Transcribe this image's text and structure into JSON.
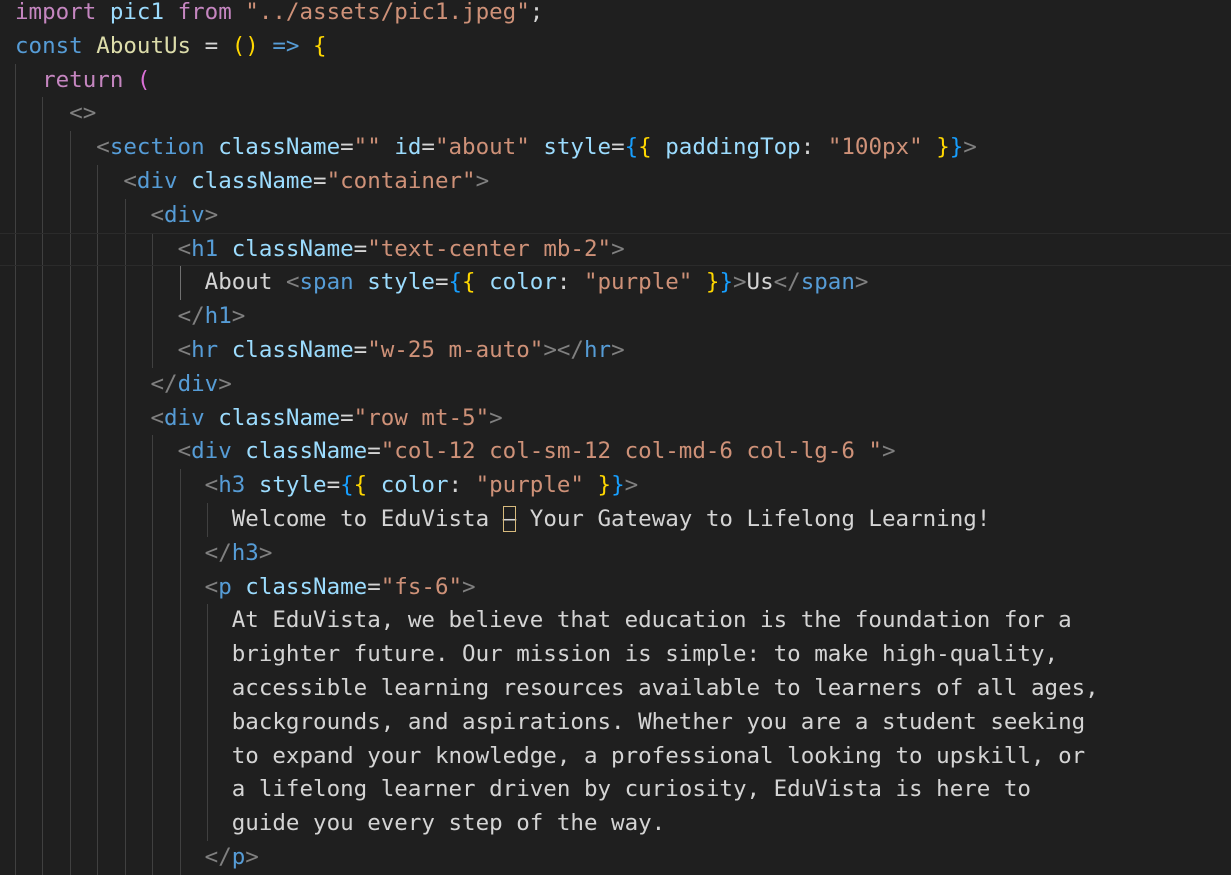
{
  "editor": {
    "lines": [
      [
        [
          "import",
          "ctl"
        ],
        [
          " ",
          "text"
        ],
        [
          "pic1",
          "var"
        ],
        [
          " ",
          "text"
        ],
        [
          "from",
          "ctl"
        ],
        [
          " ",
          "text"
        ],
        [
          "\"../assets/pic1.jpeg\"",
          "str"
        ],
        [
          ";",
          "text"
        ]
      ],
      [
        [
          "const",
          "kw"
        ],
        [
          " ",
          "text"
        ],
        [
          "AboutUs",
          "fn"
        ],
        [
          " = ",
          "op"
        ],
        [
          "()",
          "b1"
        ],
        [
          " ",
          "text"
        ],
        [
          "=>",
          "kw"
        ],
        [
          " ",
          "text"
        ],
        [
          "{",
          "b1"
        ]
      ],
      [
        [
          "  ",
          "text"
        ],
        [
          "return",
          "ctl"
        ],
        [
          " ",
          "text"
        ],
        [
          "(",
          "b2"
        ]
      ],
      [
        [
          "    ",
          "text"
        ],
        [
          "<>",
          "punc"
        ]
      ],
      [
        [
          "      ",
          "text"
        ],
        [
          "<",
          "punc"
        ],
        [
          "section",
          "tag"
        ],
        [
          " ",
          "text"
        ],
        [
          "className",
          "attr"
        ],
        [
          "=",
          "op"
        ],
        [
          "\"\"",
          "str"
        ],
        [
          " ",
          "text"
        ],
        [
          "id",
          "attr"
        ],
        [
          "=",
          "op"
        ],
        [
          "\"about\"",
          "str"
        ],
        [
          " ",
          "text"
        ],
        [
          "style",
          "attr"
        ],
        [
          "=",
          "op"
        ],
        [
          "{",
          "b3"
        ],
        [
          "{",
          "b1"
        ],
        [
          " ",
          "text"
        ],
        [
          "paddingTop",
          "var"
        ],
        [
          ": ",
          "text"
        ],
        [
          "\"100px\"",
          "str"
        ],
        [
          " ",
          "text"
        ],
        [
          "}",
          "b1"
        ],
        [
          "}",
          "b3"
        ],
        [
          ">",
          "punc"
        ]
      ],
      [
        [
          "        ",
          "text"
        ],
        [
          "<",
          "punc"
        ],
        [
          "div",
          "tag"
        ],
        [
          " ",
          "text"
        ],
        [
          "className",
          "attr"
        ],
        [
          "=",
          "op"
        ],
        [
          "\"container\"",
          "str"
        ],
        [
          ">",
          "punc"
        ]
      ],
      [
        [
          "          ",
          "text"
        ],
        [
          "<",
          "punc"
        ],
        [
          "div",
          "tag"
        ],
        [
          ">",
          "punc"
        ]
      ],
      [
        [
          "            ",
          "text"
        ],
        [
          "<",
          "punc"
        ],
        [
          "h1",
          "tag"
        ],
        [
          " ",
          "text"
        ],
        [
          "className",
          "attr"
        ],
        [
          "=",
          "op"
        ],
        [
          "\"text-center mb-2\"",
          "str"
        ],
        [
          ">",
          "punc"
        ]
      ],
      [
        [
          "              ",
          "text"
        ],
        [
          "About ",
          "text"
        ],
        [
          "<",
          "punc"
        ],
        [
          "span",
          "tag"
        ],
        [
          " ",
          "text"
        ],
        [
          "style",
          "attr"
        ],
        [
          "=",
          "op"
        ],
        [
          "{",
          "b3"
        ],
        [
          "{",
          "b1"
        ],
        [
          " ",
          "text"
        ],
        [
          "color",
          "var"
        ],
        [
          ": ",
          "text"
        ],
        [
          "\"purple\"",
          "str"
        ],
        [
          " ",
          "text"
        ],
        [
          "}",
          "b1"
        ],
        [
          "}",
          "b3"
        ],
        [
          ">",
          "punc"
        ],
        [
          "Us",
          "text"
        ],
        [
          "</",
          "punc"
        ],
        [
          "span",
          "tag"
        ],
        [
          ">",
          "punc"
        ]
      ],
      [
        [
          "            ",
          "text"
        ],
        [
          "</",
          "punc"
        ],
        [
          "h1",
          "tag"
        ],
        [
          ">",
          "punc"
        ]
      ],
      [
        [
          "            ",
          "text"
        ],
        [
          "<",
          "punc"
        ],
        [
          "hr",
          "tag"
        ],
        [
          " ",
          "text"
        ],
        [
          "className",
          "attr"
        ],
        [
          "=",
          "op"
        ],
        [
          "\"w-25 m-auto\"",
          "str"
        ],
        [
          "></",
          "punc"
        ],
        [
          "hr",
          "tag"
        ],
        [
          ">",
          "punc"
        ]
      ],
      [
        [
          "          ",
          "text"
        ],
        [
          "</",
          "punc"
        ],
        [
          "div",
          "tag"
        ],
        [
          ">",
          "punc"
        ]
      ],
      [
        [
          "          ",
          "text"
        ],
        [
          "<",
          "punc"
        ],
        [
          "div",
          "tag"
        ],
        [
          " ",
          "text"
        ],
        [
          "className",
          "attr"
        ],
        [
          "=",
          "op"
        ],
        [
          "\"row mt-5\"",
          "str"
        ],
        [
          ">",
          "punc"
        ]
      ],
      [
        [
          "            ",
          "text"
        ],
        [
          "<",
          "punc"
        ],
        [
          "div",
          "tag"
        ],
        [
          " ",
          "text"
        ],
        [
          "className",
          "attr"
        ],
        [
          "=",
          "op"
        ],
        [
          "\"col-12 col-sm-12 col-md-6 col-lg-6 \"",
          "str"
        ],
        [
          ">",
          "punc"
        ]
      ],
      [
        [
          "              ",
          "text"
        ],
        [
          "<",
          "punc"
        ],
        [
          "h3",
          "tag"
        ],
        [
          " ",
          "text"
        ],
        [
          "style",
          "attr"
        ],
        [
          "=",
          "op"
        ],
        [
          "{",
          "b3"
        ],
        [
          "{",
          "b1"
        ],
        [
          " ",
          "text"
        ],
        [
          "color",
          "var"
        ],
        [
          ": ",
          "text"
        ],
        [
          "\"purple\"",
          "str"
        ],
        [
          " ",
          "text"
        ],
        [
          "}",
          "b1"
        ],
        [
          "}",
          "b3"
        ],
        [
          ">",
          "punc"
        ]
      ],
      [
        [
          "                ",
          "text"
        ],
        [
          "Welcome to EduVista ",
          "text"
        ],
        [
          "–",
          "warn"
        ],
        [
          " Your Gateway to Lifelong Learning!",
          "text"
        ]
      ],
      [
        [
          "              ",
          "text"
        ],
        [
          "</",
          "punc"
        ],
        [
          "h3",
          "tag"
        ],
        [
          ">",
          "punc"
        ]
      ],
      [
        [
          "              ",
          "text"
        ],
        [
          "<",
          "punc"
        ],
        [
          "p",
          "tag"
        ],
        [
          " ",
          "text"
        ],
        [
          "className",
          "attr"
        ],
        [
          "=",
          "op"
        ],
        [
          "\"fs-6\"",
          "str"
        ],
        [
          ">",
          "punc"
        ]
      ],
      [
        [
          "                ",
          "text"
        ],
        [
          "At EduVista, we believe that education is the foundation for a",
          "text"
        ]
      ],
      [
        [
          "                ",
          "text"
        ],
        [
          "brighter future. Our mission is simple: to make high-quality,",
          "text"
        ]
      ],
      [
        [
          "                ",
          "text"
        ],
        [
          "accessible learning resources available to learners of all ages,",
          "text"
        ]
      ],
      [
        [
          "                ",
          "text"
        ],
        [
          "backgrounds, and aspirations. Whether you are a student seeking",
          "text"
        ]
      ],
      [
        [
          "                ",
          "text"
        ],
        [
          "to expand your knowledge, a professional looking to upskill, or",
          "text"
        ]
      ],
      [
        [
          "                ",
          "text"
        ],
        [
          "a lifelong learner driven by curiosity, EduVista is here to",
          "text"
        ]
      ],
      [
        [
          "                ",
          "text"
        ],
        [
          "guide you every step of the way.",
          "text"
        ]
      ],
      [
        [
          "              ",
          "text"
        ],
        [
          "</",
          "punc"
        ],
        [
          "p",
          "tag"
        ],
        [
          ">",
          "punc"
        ]
      ]
    ]
  }
}
